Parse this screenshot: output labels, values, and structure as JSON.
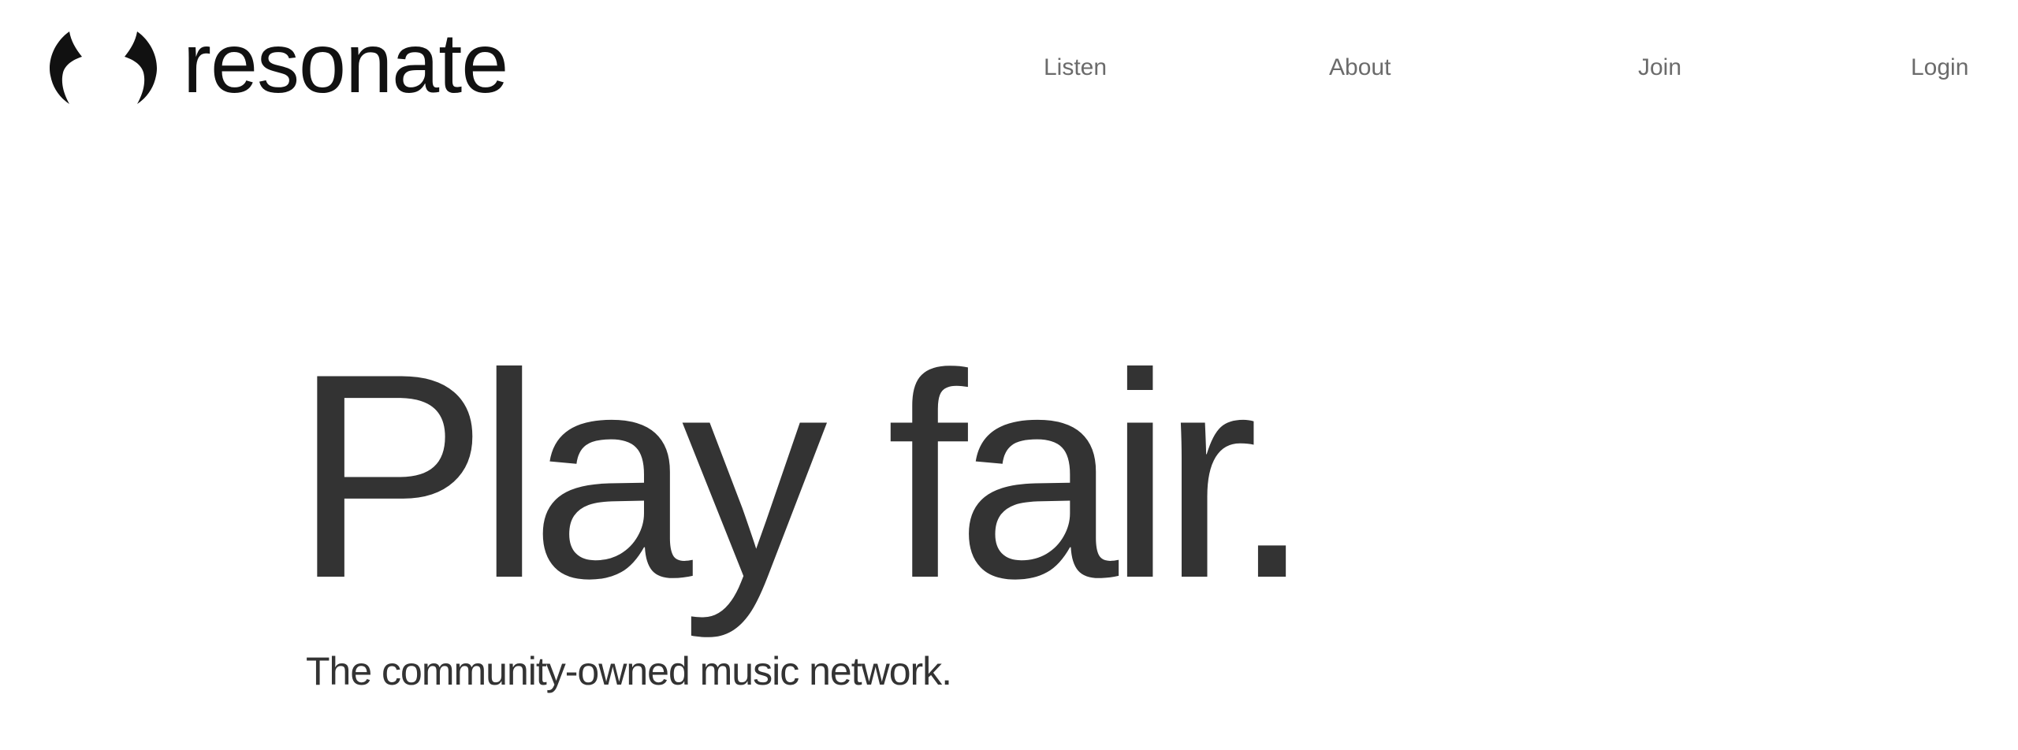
{
  "header": {
    "logo": {
      "icon": "resonate-brackets-logo-icon",
      "wordmark": "resonate"
    },
    "nav": [
      {
        "label": "Listen"
      },
      {
        "label": "About"
      },
      {
        "label": "Join"
      },
      {
        "label": "Login"
      }
    ]
  },
  "hero": {
    "title": "Play fair.",
    "subtitle": "The community-owned music network."
  },
  "colors": {
    "background": "#ffffff",
    "text": "#333333",
    "logo": "#111111",
    "nav_text": "#6b6b6b"
  }
}
